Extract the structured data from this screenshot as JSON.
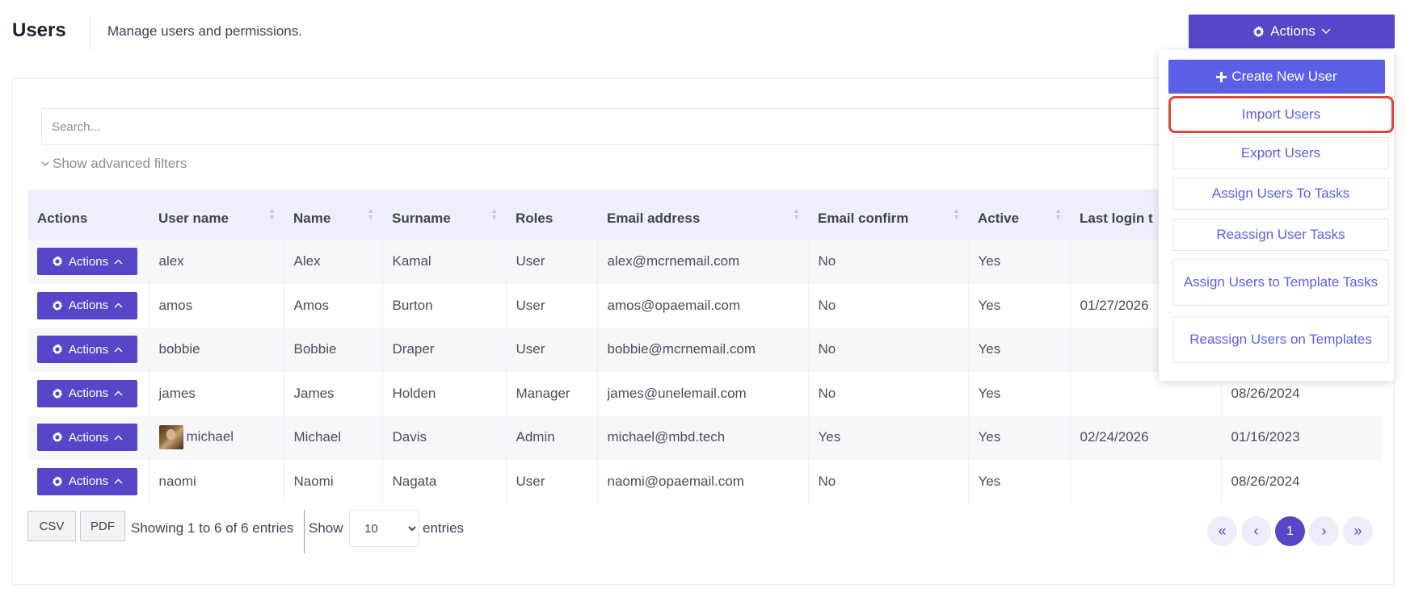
{
  "header": {
    "title": "Users",
    "subtitle": "Manage users and permissions.",
    "actions_label": "Actions"
  },
  "search": {
    "placeholder": "Search..."
  },
  "filters": {
    "advanced_label": "Show advanced filters"
  },
  "table": {
    "columns": [
      "Actions",
      "User name",
      "Name",
      "Surname",
      "Roles",
      "Email address",
      "Email confirm",
      "Active",
      "Last login t",
      ""
    ],
    "row_action_label": "Actions",
    "rows": [
      {
        "username": "alex",
        "name": "Alex",
        "surname": "Kamal",
        "role": "User",
        "email": "alex@mcrnemail.com",
        "email_confirm": "No",
        "active": "Yes",
        "last_login": "",
        "created": ""
      },
      {
        "username": "amos",
        "name": "Amos",
        "surname": "Burton",
        "role": "User",
        "email": "amos@opaemail.com",
        "email_confirm": "No",
        "active": "Yes",
        "last_login": "01/27/2026",
        "created": ""
      },
      {
        "username": "bobbie",
        "name": "Bobbie",
        "surname": "Draper",
        "role": "User",
        "email": "bobbie@mcrnemail.com",
        "email_confirm": "No",
        "active": "Yes",
        "last_login": "",
        "created": ""
      },
      {
        "username": "james",
        "name": "James",
        "surname": "Holden",
        "role": "Manager",
        "email": "james@unelemail.com",
        "email_confirm": "No",
        "active": "Yes",
        "last_login": "",
        "created": "08/26/2024"
      },
      {
        "username": "michael",
        "name": "Michael",
        "surname": "Davis",
        "role": "Admin",
        "email": "michael@mbd.tech",
        "email_confirm": "Yes",
        "active": "Yes",
        "last_login": "02/24/2026",
        "created": "01/16/2023"
      },
      {
        "username": "naomi",
        "name": "Naomi",
        "surname": "Nagata",
        "role": "User",
        "email": "naomi@opaemail.com",
        "email_confirm": "No",
        "active": "Yes",
        "last_login": "",
        "created": "08/26/2024"
      }
    ]
  },
  "footer": {
    "csv_label": "CSV",
    "pdf_label": "PDF",
    "showing_text": "Showing 1 to 6 of 6 entries",
    "show_label": "Show",
    "page_size": "10",
    "entries_label": "entries",
    "current_page": "1"
  },
  "dropdown": {
    "create_label": "Create New User",
    "items": [
      "Import Users",
      "Export Users",
      "Assign Users To Tasks",
      "Reassign User Tasks",
      "Assign Users to Template Tasks",
      "Reassign Users on Templates"
    ]
  },
  "icons": {
    "gear": "gear-icon",
    "chevron_down": "chevron-down-icon",
    "chevron_up": "chevron-up-icon",
    "plus": "plus-icon",
    "sort": "sort-icon"
  },
  "colors": {
    "primary": "#5846c8",
    "link": "#5a5fe6",
    "highlight": "#d9473a",
    "header_row": "#eeeffa"
  }
}
